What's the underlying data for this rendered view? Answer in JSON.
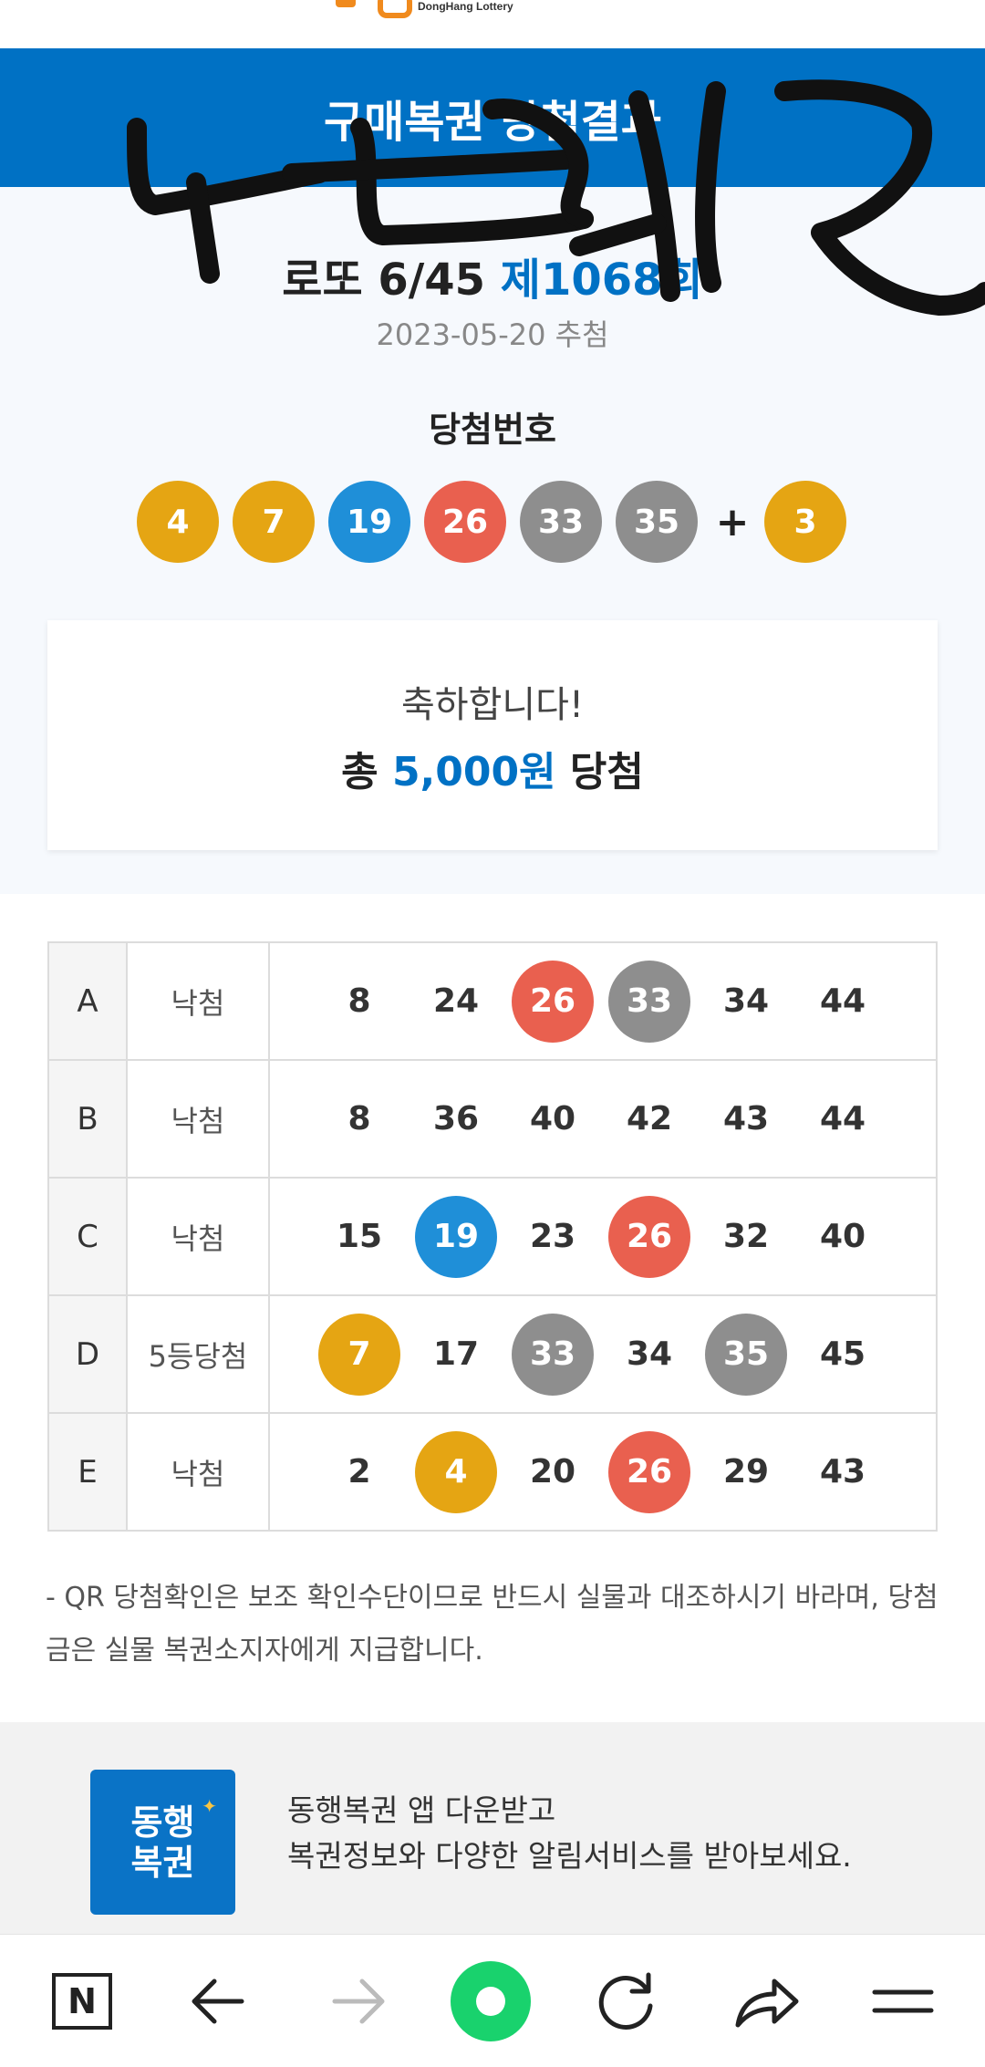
{
  "header": {
    "logo_text": "DongHang Lottery",
    "title": "구매복권 당첨결과"
  },
  "draw": {
    "game_name": "로또 6/45",
    "round": "제1068회",
    "date": "2023-05-20 추첨",
    "winning_label": "당첨번호",
    "winning_numbers": [
      {
        "value": "4",
        "color": "#e5a513"
      },
      {
        "value": "7",
        "color": "#e5a513"
      },
      {
        "value": "19",
        "color": "#1f8fd8"
      },
      {
        "value": "26",
        "color": "#e9604f"
      },
      {
        "value": "33",
        "color": "#8e8e8e"
      },
      {
        "value": "35",
        "color": "#8e8e8e"
      }
    ],
    "plus": "+",
    "bonus": {
      "value": "3",
      "color": "#e5a513"
    }
  },
  "result": {
    "congrats": "축하합니다!",
    "prize_prefix": "총 ",
    "prize_amount": "5,000원",
    "prize_suffix": " 당첨"
  },
  "games": [
    {
      "label": "A",
      "result": "낙첨",
      "numbers": [
        {
          "v": "8",
          "c": ""
        },
        {
          "v": "24",
          "c": ""
        },
        {
          "v": "26",
          "c": "#e9604f"
        },
        {
          "v": "33",
          "c": "#8e8e8e"
        },
        {
          "v": "34",
          "c": ""
        },
        {
          "v": "44",
          "c": ""
        }
      ]
    },
    {
      "label": "B",
      "result": "낙첨",
      "numbers": [
        {
          "v": "8",
          "c": ""
        },
        {
          "v": "36",
          "c": ""
        },
        {
          "v": "40",
          "c": ""
        },
        {
          "v": "42",
          "c": ""
        },
        {
          "v": "43",
          "c": ""
        },
        {
          "v": "44",
          "c": ""
        }
      ]
    },
    {
      "label": "C",
      "result": "낙첨",
      "numbers": [
        {
          "v": "15",
          "c": ""
        },
        {
          "v": "19",
          "c": "#1f8fd8"
        },
        {
          "v": "23",
          "c": ""
        },
        {
          "v": "26",
          "c": "#e9604f"
        },
        {
          "v": "32",
          "c": ""
        },
        {
          "v": "40",
          "c": ""
        }
      ]
    },
    {
      "label": "D",
      "result": "5등당첨",
      "numbers": [
        {
          "v": "7",
          "c": "#e5a513"
        },
        {
          "v": "17",
          "c": ""
        },
        {
          "v": "33",
          "c": "#8e8e8e"
        },
        {
          "v": "34",
          "c": ""
        },
        {
          "v": "35",
          "c": "#8e8e8e"
        },
        {
          "v": "45",
          "c": ""
        }
      ]
    },
    {
      "label": "E",
      "result": "낙첨",
      "numbers": [
        {
          "v": "2",
          "c": ""
        },
        {
          "v": "4",
          "c": "#e5a513"
        },
        {
          "v": "20",
          "c": ""
        },
        {
          "v": "26",
          "c": "#e9604f"
        },
        {
          "v": "29",
          "c": ""
        },
        {
          "v": "43",
          "c": ""
        }
      ]
    }
  ],
  "notice": "- QR 당첨확인은 보조 확인수단이므로 반드시 실물과 대조하시기 바라며, 당첨금은 실물 복권소지자에게 지급합니다.",
  "promo": {
    "logo_line1": "동행",
    "logo_line2": "복권",
    "line1": "동행복권 앱 다운받고",
    "line2": "복권정보와 다양한 알림서비스를 받아보세요."
  },
  "browser_bar": {
    "home_label": "N",
    "icons": [
      "naver-home-icon",
      "back-arrow-icon",
      "forward-arrow-icon",
      "green-circle-icon",
      "reload-icon",
      "share-icon",
      "menu-icon"
    ]
  },
  "colors": {
    "brand_blue": "#0071c4",
    "ball_yellow": "#e5a513",
    "ball_blue": "#1f8fd8",
    "ball_red": "#e9604f",
    "ball_gray": "#8e8e8e",
    "nav_green": "#19d26d"
  }
}
